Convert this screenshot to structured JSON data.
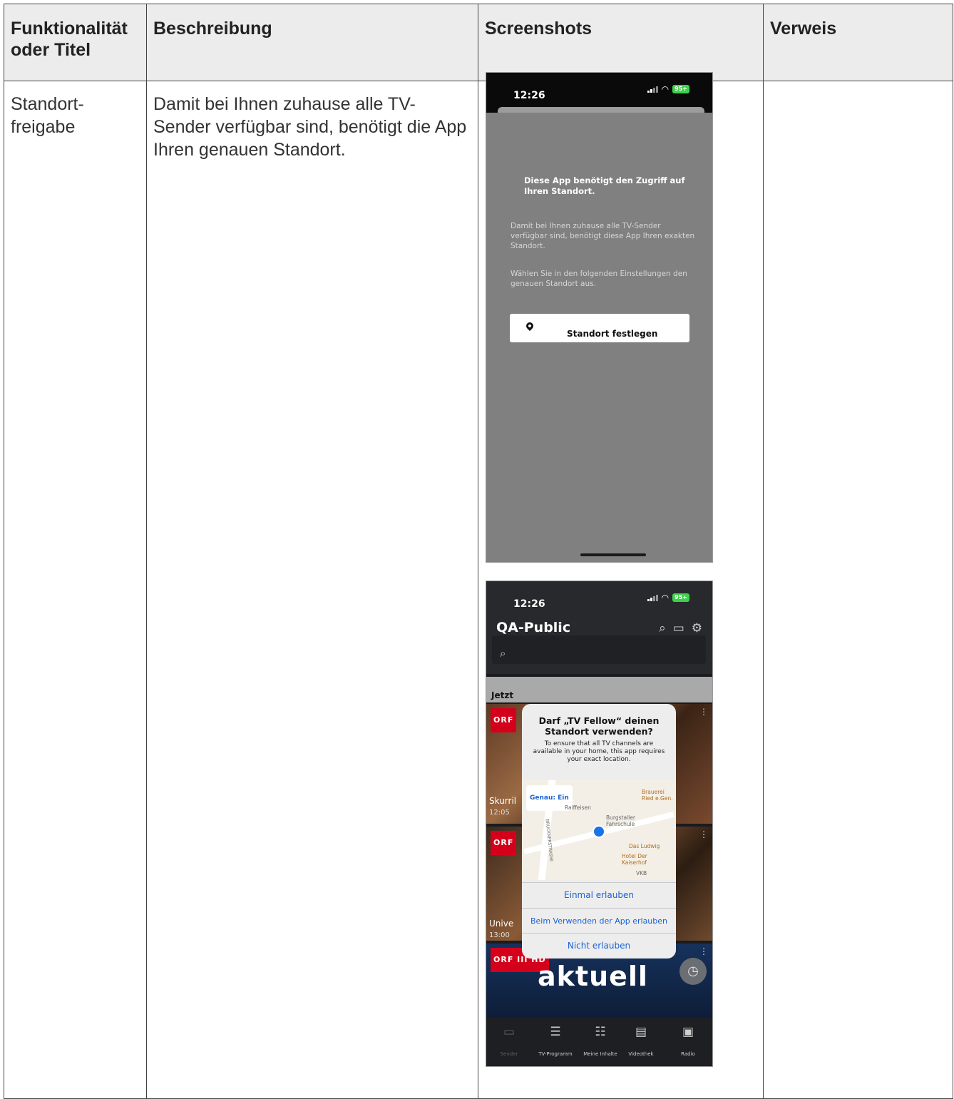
{
  "table": {
    "headers": [
      "Funktionalität oder Titel",
      "Beschreibung",
      "Screenshots",
      "Verweis"
    ],
    "row": {
      "title": "Standort-\nfreigabe",
      "description": "Damit bei Ihnen zuhause alle TV-Sender verfügbar sind, benötigt die App Ihren genauen Standort.",
      "reference": ""
    }
  },
  "screenshot1": {
    "time": "12:26",
    "battery": "95+",
    "title": "Diese App benötigt den Zugriff auf Ihren Standort.",
    "text1": "Damit bei Ihnen zuhause alle TV-Sender verfügbar sind, benötigt diese App Ihren exakten Standort.",
    "text2": "Wählen Sie in den folgenden Einstellungen den genauen Standort aus.",
    "button": "Standort festlegen"
  },
  "screenshot2": {
    "time": "12:26",
    "battery": "95+",
    "app_title": "QA-Public",
    "section": "Jetzt",
    "tiles": [
      {
        "channel": "ORF",
        "label": "Skurril",
        "time": "12:05"
      },
      {
        "channel": "ORF",
        "label": "Unive",
        "time": "13:00"
      },
      {
        "channel": "ORF III HD",
        "banner": "aktuell"
      }
    ],
    "dialog": {
      "title": "Darf „TV Fellow“ deinen Standort verwenden?",
      "text": "To ensure that all TV channels are available in your home, this app requires your exact location.",
      "precise": "Genau: Ein",
      "pois": [
        "Raiffeisen",
        "Burgstaller Fahrschule",
        "Brauerei Ried e.Gen.",
        "Das Ludwig",
        "Hotel Der Kaiserhof",
        "VKB",
        "BRUCKNERSTRASSE"
      ],
      "buttons": [
        "Einmal erlauben",
        "Beim Verwenden der App erlauben",
        "Nicht erlauben"
      ]
    },
    "tabs": [
      "Sender",
      "TV-Programm",
      "Meine Inhalte",
      "Videothek",
      "Radio"
    ]
  }
}
